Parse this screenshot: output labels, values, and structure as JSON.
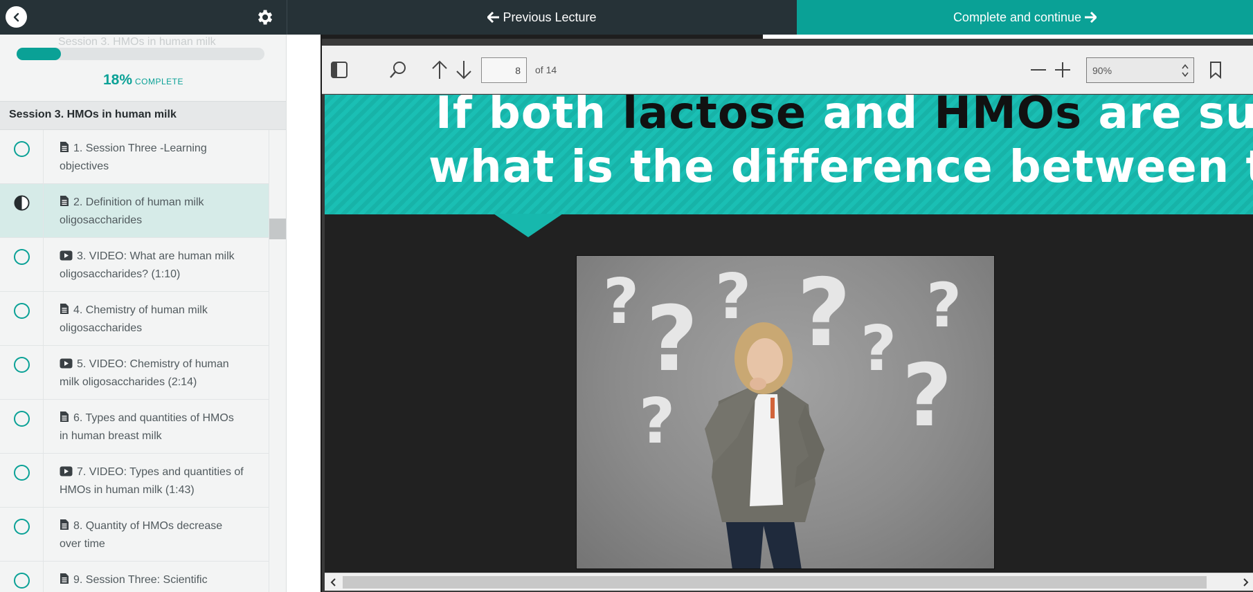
{
  "topbar": {
    "prev_label": "Previous Lecture",
    "next_label": "Complete and continue"
  },
  "sidebar": {
    "ghost_title": "Session 3. HMOs in human milk",
    "progress_percent": 18,
    "progress_pct_label": "18%",
    "progress_complete_label": "COMPLETE",
    "section_title": "Session 3. HMOs in human milk",
    "items": [
      {
        "type": "document",
        "status": "not-started",
        "line1": "1. Session Three -Learning",
        "line2": "objectives"
      },
      {
        "type": "document",
        "status": "in-progress",
        "line1": "2. Definition of human milk",
        "line2": "oligosaccharides"
      },
      {
        "type": "video",
        "status": "not-started",
        "line1": "3. VIDEO: What are human milk",
        "line2": "oligosaccharides? (1:10)"
      },
      {
        "type": "document",
        "status": "not-started",
        "line1": "4. Chemistry of human milk",
        "line2": "oligosaccharides"
      },
      {
        "type": "video",
        "status": "not-started",
        "line1": "5. VIDEO: Chemistry of human",
        "line2": "milk oligosaccharides (2:14)"
      },
      {
        "type": "document",
        "status": "not-started",
        "line1": "6. Types and quantities of HMOs",
        "line2": "in human breast milk"
      },
      {
        "type": "video",
        "status": "not-started",
        "line1": "7. VIDEO: Types and quantities of",
        "line2": "HMOs in human milk (1:43)"
      },
      {
        "type": "document",
        "status": "not-started",
        "line1": "8. Quantity of HMOs decrease",
        "line2": "over time"
      },
      {
        "type": "document",
        "status": "not-started",
        "line1": "9. Session Three: Scientific",
        "line2": ""
      }
    ]
  },
  "viewer": {
    "page_number": "8",
    "page_total_label": "of 14",
    "zoom_value": "90%"
  },
  "slide": {
    "line1_a": "If both ",
    "line1_b": "lactose",
    "line1_c": " and ",
    "line1_d": "HMOs",
    "line1_e": " are sugars,",
    "line2": "what is the difference between them?"
  },
  "colors": {
    "accent": "#0aa196",
    "dark_bar": "#263237",
    "banner": "#1abfb4"
  },
  "icons": {
    "back": "chevron-left-icon",
    "settings": "gear-icon",
    "document": "document-icon",
    "video": "video-play-icon"
  }
}
